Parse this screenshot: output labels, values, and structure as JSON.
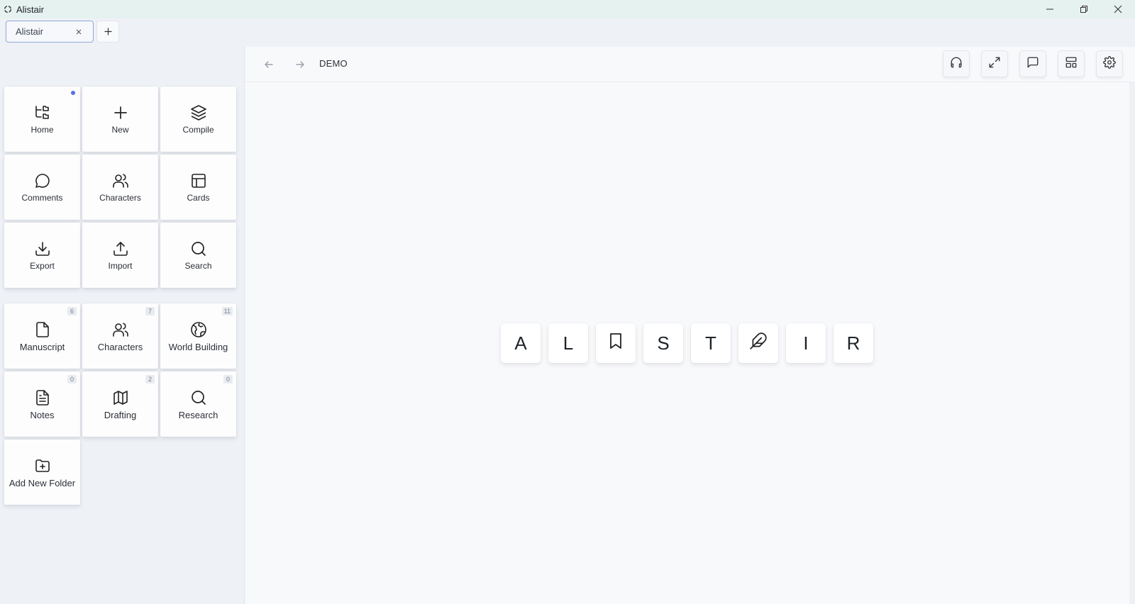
{
  "window": {
    "title": "Alistair"
  },
  "tabs": [
    {
      "label": "Alistair"
    }
  ],
  "sidebar": {
    "actions": [
      {
        "label": "Home",
        "icon": "folder-tree-icon"
      },
      {
        "label": "New",
        "icon": "plus-icon"
      },
      {
        "label": "Compile",
        "icon": "layers-icon"
      },
      {
        "label": "Comments",
        "icon": "comment-icon"
      },
      {
        "label": "Characters",
        "icon": "users-icon"
      },
      {
        "label": "Cards",
        "icon": "cards-icon"
      },
      {
        "label": "Export",
        "icon": "download-icon"
      },
      {
        "label": "Import",
        "icon": "upload-icon"
      },
      {
        "label": "Search",
        "icon": "search-icon"
      }
    ],
    "folders": [
      {
        "label": "Manuscript",
        "count": "6",
        "icon": "file-icon"
      },
      {
        "label": "Characters",
        "count": "7",
        "icon": "users-icon"
      },
      {
        "label": "World Building",
        "count": "11",
        "icon": "globe-icon"
      },
      {
        "label": "Notes",
        "count": "0",
        "icon": "document-icon"
      },
      {
        "label": "Drafting",
        "count": "2",
        "icon": "map-icon"
      },
      {
        "label": "Research",
        "count": "0",
        "icon": "search-icon"
      }
    ],
    "add_folder": {
      "label": "Add New Folder",
      "icon": "folder-plus-icon"
    }
  },
  "main": {
    "breadcrumb": "DEMO",
    "toolbar": [
      {
        "name": "headphones-icon"
      },
      {
        "name": "expand-icon"
      },
      {
        "name": "message-icon"
      },
      {
        "name": "layout-icon"
      },
      {
        "name": "gear-icon"
      }
    ],
    "logo_keys": [
      {
        "text": "A"
      },
      {
        "text": "L"
      },
      {
        "text": "",
        "icon": "bookmark-icon"
      },
      {
        "text": "S"
      },
      {
        "text": "T"
      },
      {
        "text": "",
        "icon": "feather-icon"
      },
      {
        "text": "I"
      },
      {
        "text": "R"
      }
    ]
  },
  "colors": {
    "accent": "#5b6fe0",
    "tab_border": "#8fa8d8",
    "titlebar": "#e6f2f0"
  }
}
